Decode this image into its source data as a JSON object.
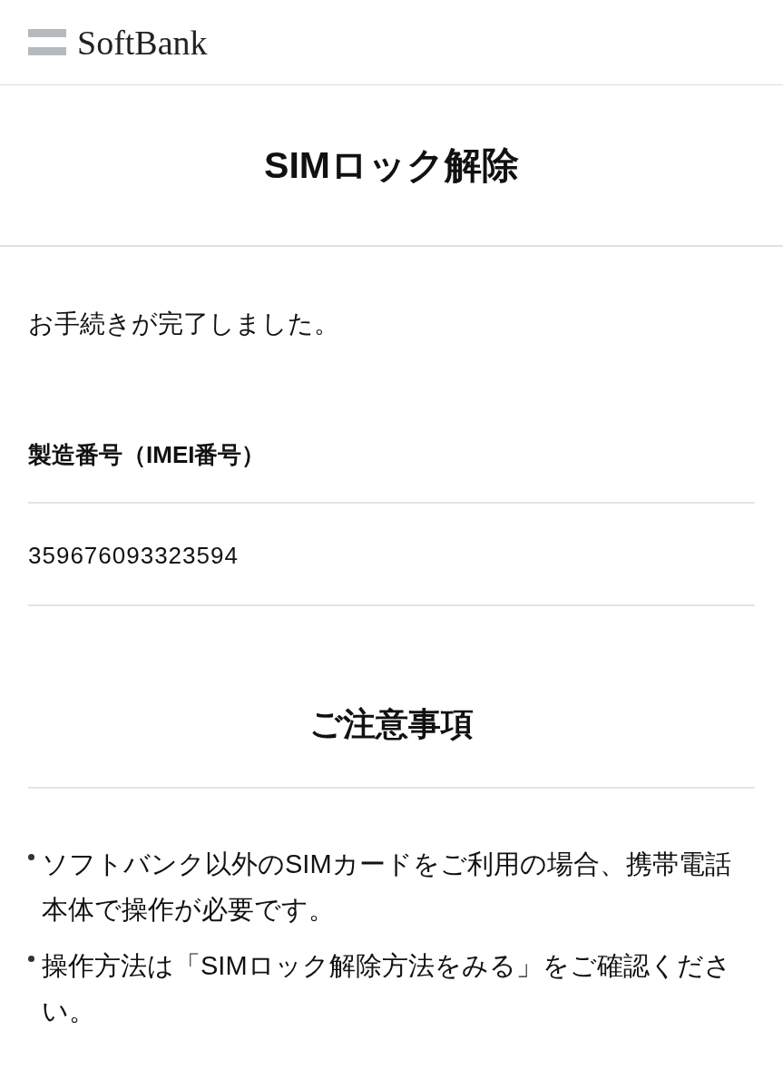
{
  "header": {
    "logo": "SoftBank"
  },
  "page_title": "SIMロック解除",
  "message": "お手続きが完了しました。",
  "imei": {
    "label": "製造番号（IMEI番号）",
    "value": "359676093323594"
  },
  "notes": {
    "title": "ご注意事項",
    "items": [
      "ソフトバンク以外のSIMカードをご利用の場合、携帯電話本体で操作が必要です。",
      "操作方法は「SIMロック解除方法をみる」をご確認ください。"
    ]
  }
}
